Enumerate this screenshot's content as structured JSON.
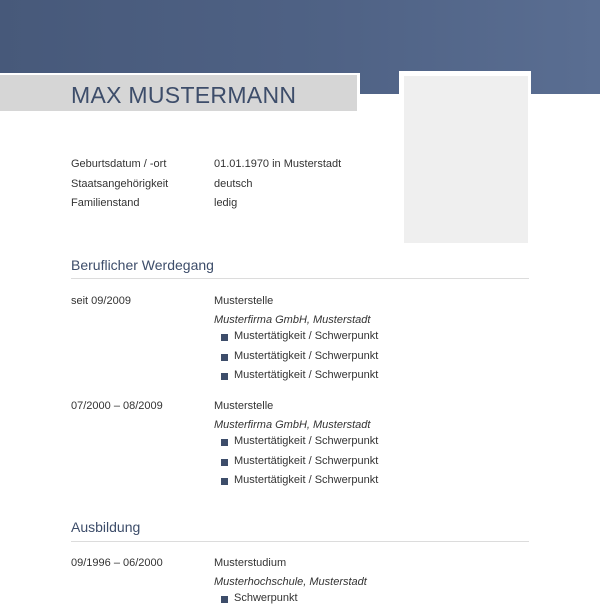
{
  "name": "MAX MUSTERMANN",
  "personal": [
    {
      "label": "Geburtsdatum / -ort",
      "value": "01.01.1970 in Musterstadt"
    },
    {
      "label": "Staatsangehörigkeit",
      "value": "deutsch"
    },
    {
      "label": "Familienstand",
      "value": "ledig"
    }
  ],
  "career": {
    "title": "Beruflicher Werdegang",
    "entries": [
      {
        "date": "seit 09/2009",
        "position": "Musterstelle",
        "company": "Musterfirma GmbH, Musterstadt",
        "items": [
          "Mustertätigkeit / Schwerpunkt",
          "Mustertätigkeit / Schwerpunkt",
          "Mustertätigkeit / Schwerpunkt"
        ]
      },
      {
        "date": "07/2000 – 08/2009",
        "position": "Musterstelle",
        "company": "Musterfirma GmbH, Musterstadt",
        "items": [
          "Mustertätigkeit / Schwerpunkt",
          "Mustertätigkeit / Schwerpunkt",
          "Mustertätigkeit / Schwerpunkt"
        ]
      }
    ]
  },
  "education": {
    "title": "Ausbildung",
    "entries": [
      {
        "date": "09/1996 – 06/2000",
        "position": "Musterstudium",
        "company": "Musterhochschule, Musterstadt",
        "items": [
          "Schwerpunkt"
        ]
      }
    ]
  },
  "colors": {
    "header": "#4f6285",
    "accent": "#3d4d6a",
    "name_bar": "#d6d6d6",
    "photo": "#efefef"
  }
}
